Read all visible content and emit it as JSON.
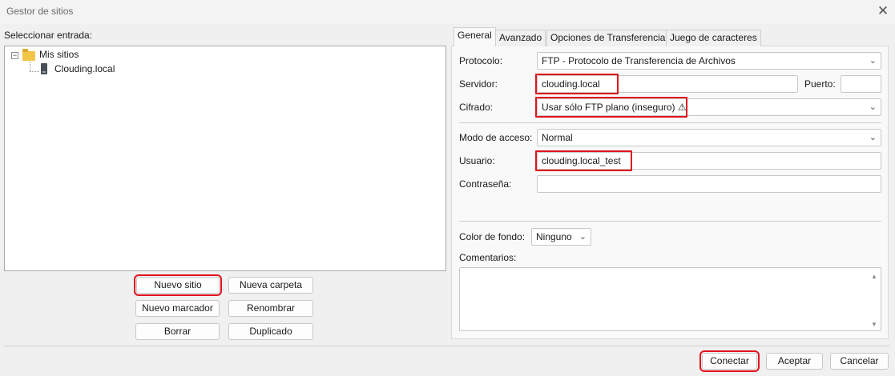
{
  "window": {
    "title": "Gestor de sitios",
    "close": "✕"
  },
  "left": {
    "select_label": "Seleccionar entrada:",
    "tree": {
      "root_label": "Mis sitios",
      "root_expander": "−",
      "child_label": "Clouding.local"
    },
    "buttons": {
      "new_site": "Nuevo sitio",
      "new_folder": "Nueva carpeta",
      "new_bookmark": "Nuevo marcador",
      "rename": "Renombrar",
      "delete": "Borrar",
      "duplicate": "Duplicado"
    }
  },
  "tabs": [
    "General",
    "Avanzado",
    "Opciones de Transferencia",
    "Juego de caracteres"
  ],
  "general": {
    "protocol_label": "Protocolo:",
    "protocol_value": "FTP - Protocolo de Transferencia de Archivos",
    "server_label": "Servidor:",
    "server_value": "clouding.local",
    "port_label": "Puerto:",
    "port_value": "",
    "encryption_label": "Cifrado:",
    "encryption_value": "Usar sólo FTP plano (inseguro) ⚠",
    "access_mode_label": "Modo de acceso:",
    "access_mode_value": "Normal",
    "user_label": "Usuario:",
    "user_value": "clouding.local_test",
    "password_label": "Contraseña:",
    "password_value": "",
    "bg_color_label": "Color de fondo:",
    "bg_color_value": "Ninguno",
    "comments_label": "Comentarios:",
    "comments_value": ""
  },
  "footer": {
    "connect": "Conectar",
    "accept": "Aceptar",
    "cancel": "Cancelar"
  },
  "icons": {
    "close": "close-icon",
    "folder": "folder-icon",
    "server": "server-icon",
    "dropdown": "chevron-down-icon",
    "warning": "warning-icon"
  },
  "colors": {
    "highlight": "#e0141e",
    "folder": "#f2c447"
  }
}
